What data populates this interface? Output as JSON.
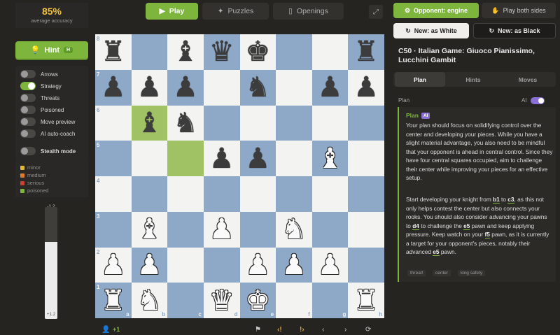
{
  "left": {
    "accuracy": {
      "value": "85%",
      "label": "average accuracy"
    },
    "hint": {
      "label": "Hint",
      "kbd": "H"
    },
    "toggles": [
      {
        "label": "Arrows",
        "on": false
      },
      {
        "label": "Strategy",
        "on": true
      },
      {
        "label": "Threats",
        "on": false
      },
      {
        "label": "Poisoned",
        "on": false
      },
      {
        "label": "Move preview",
        "on": false
      },
      {
        "label": "AI auto-coach",
        "on": false
      },
      {
        "label": "Stealth mode",
        "on": false
      }
    ],
    "legend": [
      {
        "label": "minor",
        "color": "#e0b93a"
      },
      {
        "label": "medium",
        "color": "#e07b2a"
      },
      {
        "label": "serious",
        "color": "#c9402f"
      },
      {
        "label": "poisoned",
        "color": "#7eb63d"
      }
    ],
    "eval": {
      "top": "-1.2",
      "bottom": "+1.2",
      "white_fraction": 0.69
    }
  },
  "nav": {
    "play": "Play",
    "puzzles": "Puzzles",
    "openings": "Openings"
  },
  "board": {
    "files": [
      "a",
      "b",
      "c",
      "d",
      "e",
      "f",
      "g",
      "h"
    ],
    "ranks": [
      "8",
      "7",
      "6",
      "5",
      "4",
      "3",
      "2",
      "1"
    ],
    "rows": [
      [
        "bR",
        "",
        "bB",
        "bQ",
        "bK",
        "",
        "",
        "bR"
      ],
      [
        "bP",
        "bP",
        "bP",
        "",
        "bN",
        "",
        "bP",
        "bP"
      ],
      [
        "",
        "bB",
        "bN",
        "",
        "",
        "",
        "",
        ""
      ],
      [
        "",
        "",
        "",
        "bP",
        "bP",
        "",
        "wB",
        ""
      ],
      [
        "",
        "",
        "",
        "",
        "",
        "",
        "",
        ""
      ],
      [
        "",
        "wB",
        "",
        "wP",
        "",
        "wN",
        "",
        ""
      ],
      [
        "wP",
        "wP",
        "",
        "",
        "wP",
        "wP",
        "wP",
        ""
      ],
      [
        "wR",
        "wN",
        "",
        "wQ",
        "wK",
        "",
        "",
        "wR"
      ]
    ],
    "highlights": [
      "b6",
      "c5"
    ]
  },
  "controls": {
    "eval_text": "+1"
  },
  "right": {
    "opponent": "Opponent: engine",
    "play_both": "Play both sides",
    "new_white": "New: as White",
    "new_black": "New: as Black",
    "opening": "C50 · Italian Game: Giuoco Pianissimo, Lucchini Gambit",
    "tabs": [
      "Plan",
      "Hints",
      "Moves"
    ],
    "plan_header": "Plan",
    "ai_label": "AI",
    "plan_title": "Plan",
    "ai_badge": "AI",
    "para1": "Your plan should focus on solidifying control over the center and developing your pieces. While you have a slight material advantage, you also need to be mindful that your opponent is ahead in central control. Since they have four central squares occupied, aim to challenge their center while improving your pieces for an effective setup.",
    "p2": {
      "t1": "Start developing your knight from ",
      "m1": "b1",
      "t2": " to ",
      "m2": "c3",
      "t3": ", as this not only helps contest the center but also connects your rooks. You should also consider advancing your pawns to ",
      "m3": "d4",
      "t4": " to challenge the ",
      "m4": "e5",
      "t5": " pawn and keep applying pressure. Keep watch on your ",
      "m5": "f5",
      "t6": " pawn, as it is currently a target for your opponent's pieces, notably their advanced ",
      "m6": "e5",
      "t7": " pawn."
    },
    "tags": [
      "threat!",
      "center",
      "king safety"
    ]
  }
}
